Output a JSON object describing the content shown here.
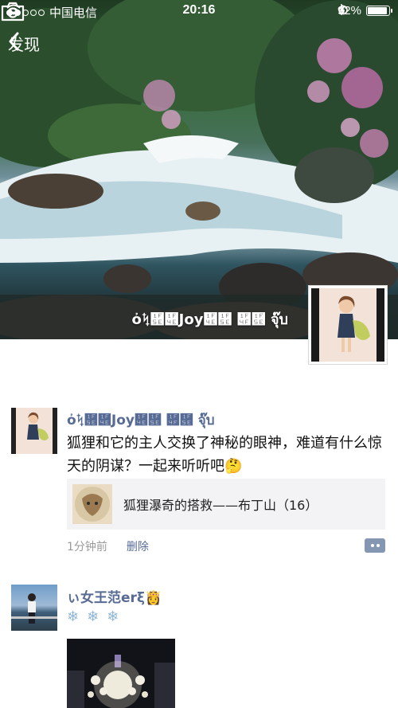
{
  "status_bar": {
    "carrier": "中国电信",
    "time": "20:16",
    "battery_percent": "92%",
    "battery_level": 0.92
  },
  "nav": {
    "back_label": "发现"
  },
  "cover": {
    "owner_name": "ὀᛪ὞὎Joy὎὞ ὏὞ จุ๊บ"
  },
  "feed": [
    {
      "author": "ὀᛪ὞὎Joy὎὞ ὏὞ จุ๊บ",
      "text": "狐狸和它的主人交换了神秘的眼神，难道有什么惊天的阴谋？一起来听听吧🤔",
      "share_title": "狐狸瀑奇的搭救——布丁山（16）",
      "time": "1分钟前",
      "delete_label": "删除"
    },
    {
      "author": "ぃ女王范erξ👸",
      "snowflakes": "❄❄❄"
    }
  ]
}
